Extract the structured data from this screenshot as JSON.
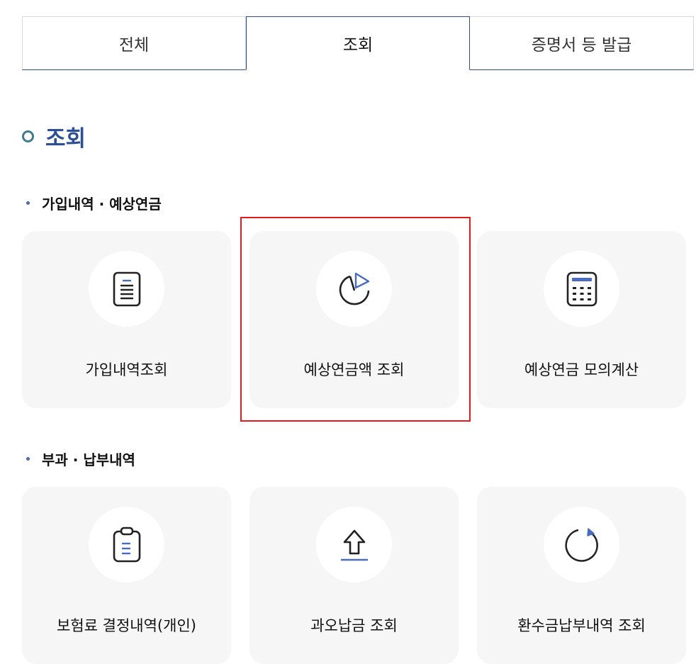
{
  "tabs": [
    {
      "label": "전체",
      "active": false
    },
    {
      "label": "조회",
      "active": true
    },
    {
      "label": "증명서 등 발급",
      "active": false
    }
  ],
  "section_title": "조회",
  "groups": [
    {
      "heading": "가입내역 · 예상연금",
      "cards": [
        {
          "label": "가입내역조회",
          "icon": "document-icon"
        },
        {
          "label": "예상연금액 조회",
          "icon": "pie-chart-icon"
        },
        {
          "label": "예상연금 모의계산",
          "icon": "calculator-icon"
        }
      ]
    },
    {
      "heading": "부과 · 납부내역",
      "cards": [
        {
          "label": "보험료 결정내역(개인)",
          "icon": "clipboard-icon"
        },
        {
          "label": "과오납금 조회",
          "icon": "upload-arrow-icon"
        },
        {
          "label": "환수금납부내역 조회",
          "icon": "refresh-icon"
        }
      ]
    }
  ],
  "colors": {
    "accent": "#2d4f95",
    "highlight": "#e51a1a",
    "card_bg": "#f6f6f6"
  }
}
